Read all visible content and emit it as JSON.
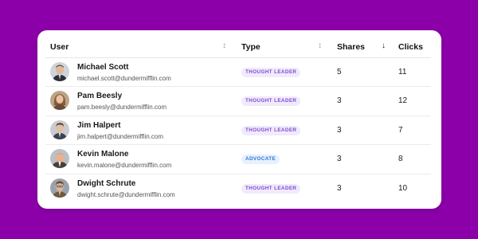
{
  "colors": {
    "background": "#8b00a8",
    "card": "#ffffff",
    "thought_leader_bg": "#f1eafc",
    "thought_leader_text": "#7b4bd1",
    "advocate_bg": "#e7f0fd",
    "advocate_text": "#2f74d6"
  },
  "table": {
    "columns": {
      "user": "User",
      "type": "Type",
      "shares": "Shares",
      "clicks": "Clicks"
    },
    "sort_icons": {
      "user": "↕",
      "type": "↕",
      "shares": "↓"
    },
    "rows": [
      {
        "name": "Michael Scott",
        "email": "michael.scott@dundermifflin.com",
        "type": "THOUGHT LEADER",
        "shares": "5",
        "clicks": "11"
      },
      {
        "name": "Pam Beesly",
        "email": "pam.beesly@dundermifflin.com",
        "type": "THOUGHT LEADER",
        "shares": "3",
        "clicks": "12"
      },
      {
        "name": "Jim Halpert",
        "email": "jim.halpert@dundermifflin.com",
        "type": "THOUGHT LEADER",
        "shares": "3",
        "clicks": "7"
      },
      {
        "name": "Kevin Malone",
        "email": "kevin.malone@dundermifflin.com",
        "type": "ADVOCATE",
        "shares": "3",
        "clicks": "8"
      },
      {
        "name": "Dwight Schrute",
        "email": "dwight.schrute@dundermifflin.com",
        "type": "THOUGHT LEADER",
        "shares": "3",
        "clicks": "10"
      }
    ]
  }
}
